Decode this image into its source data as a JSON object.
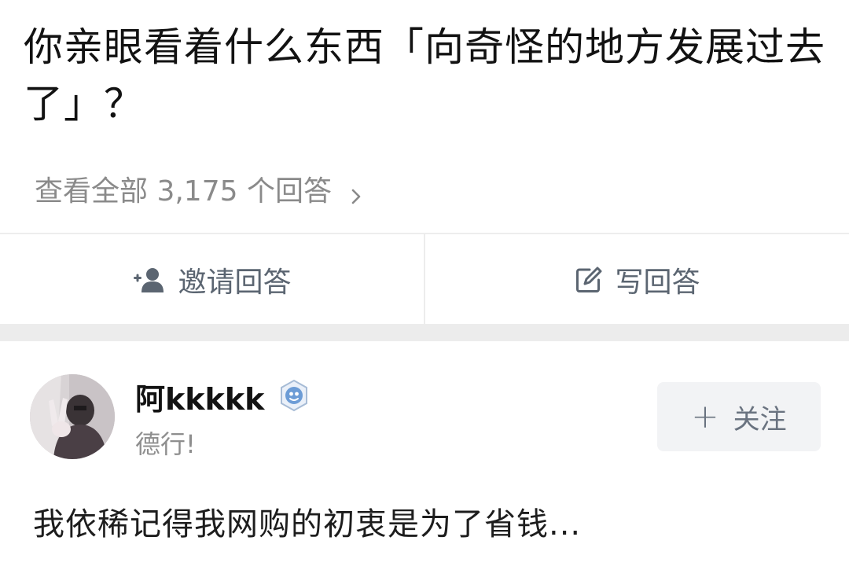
{
  "question": {
    "title": "你亲眼看着什么东西「向奇怪的地方发展过去了」？",
    "view_all_label": "查看全部 3,175 个回答"
  },
  "actions": {
    "invite_label": "邀请回答",
    "write_label": "写回答"
  },
  "answer": {
    "author_name": "阿kkkkk",
    "author_bio": "德行!",
    "follow_label": "关注",
    "excerpt": "我依稀记得我网购的初衷是为了省钱..."
  },
  "colors": {
    "title": "#121212",
    "muted": "#8a8a8a",
    "action_text": "#5b6571",
    "separator": "#ececec",
    "follow_bg": "#f2f3f5",
    "badge_blue": "#6c9cd6"
  },
  "icons": {
    "view_all": "chevron-right-icon",
    "invite": "add-user-icon",
    "write": "edit-icon",
    "badge": "creator-badge-icon",
    "follow": "plus-icon"
  }
}
